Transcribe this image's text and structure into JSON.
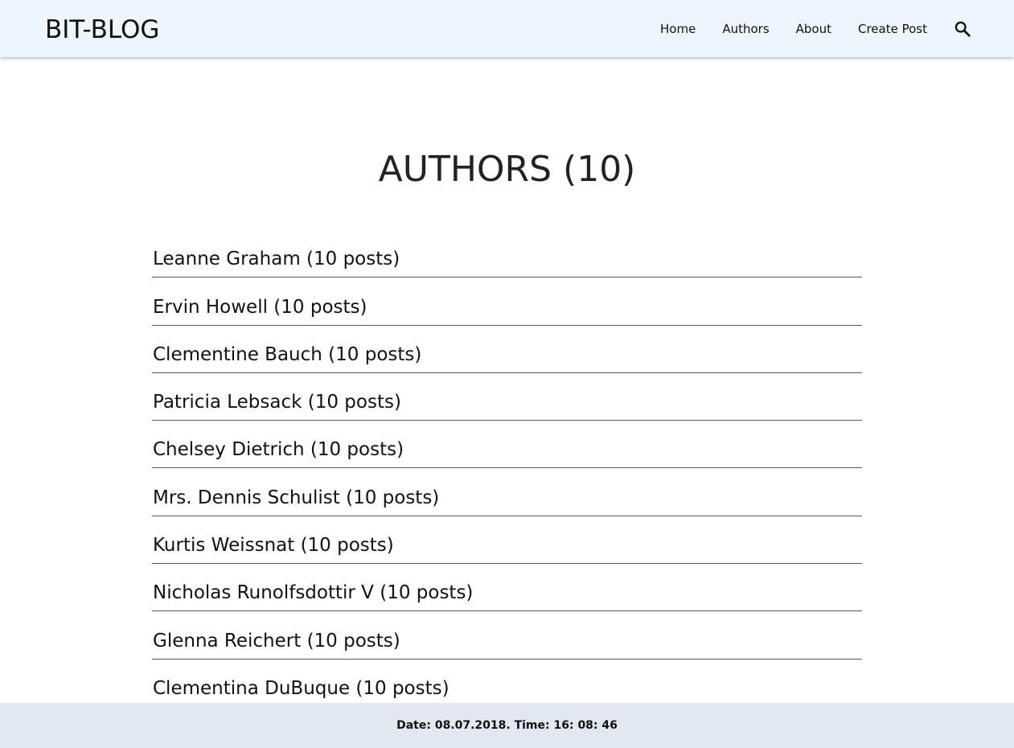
{
  "header": {
    "brand": "BIT-BLOG",
    "nav": {
      "home": "Home",
      "authors": "Authors",
      "about": "About",
      "create_post": "Create Post"
    },
    "search_icon": "search-icon"
  },
  "main": {
    "title": "AUTHORS (10)",
    "authors": [
      {
        "label": "Leanne Graham (10 posts)"
      },
      {
        "label": "Ervin Howell (10 posts)"
      },
      {
        "label": "Clementine Bauch (10 posts)"
      },
      {
        "label": "Patricia Lebsack (10 posts)"
      },
      {
        "label": "Chelsey Dietrich (10 posts)"
      },
      {
        "label": "Mrs. Dennis Schulist (10 posts)"
      },
      {
        "label": "Kurtis Weissnat (10 posts)"
      },
      {
        "label": "Nicholas Runolfsdottir V (10 posts)"
      },
      {
        "label": "Glenna Reichert (10 posts)"
      },
      {
        "label": "Clementina DuBuque (10 posts)"
      }
    ]
  },
  "footer": {
    "text": "Date: 08.07.2018. Time: 16: 08: 46"
  },
  "colors": {
    "header_bg": "#eef6fd",
    "footer_bg": "#e2e8ef",
    "divider": "#555555"
  }
}
